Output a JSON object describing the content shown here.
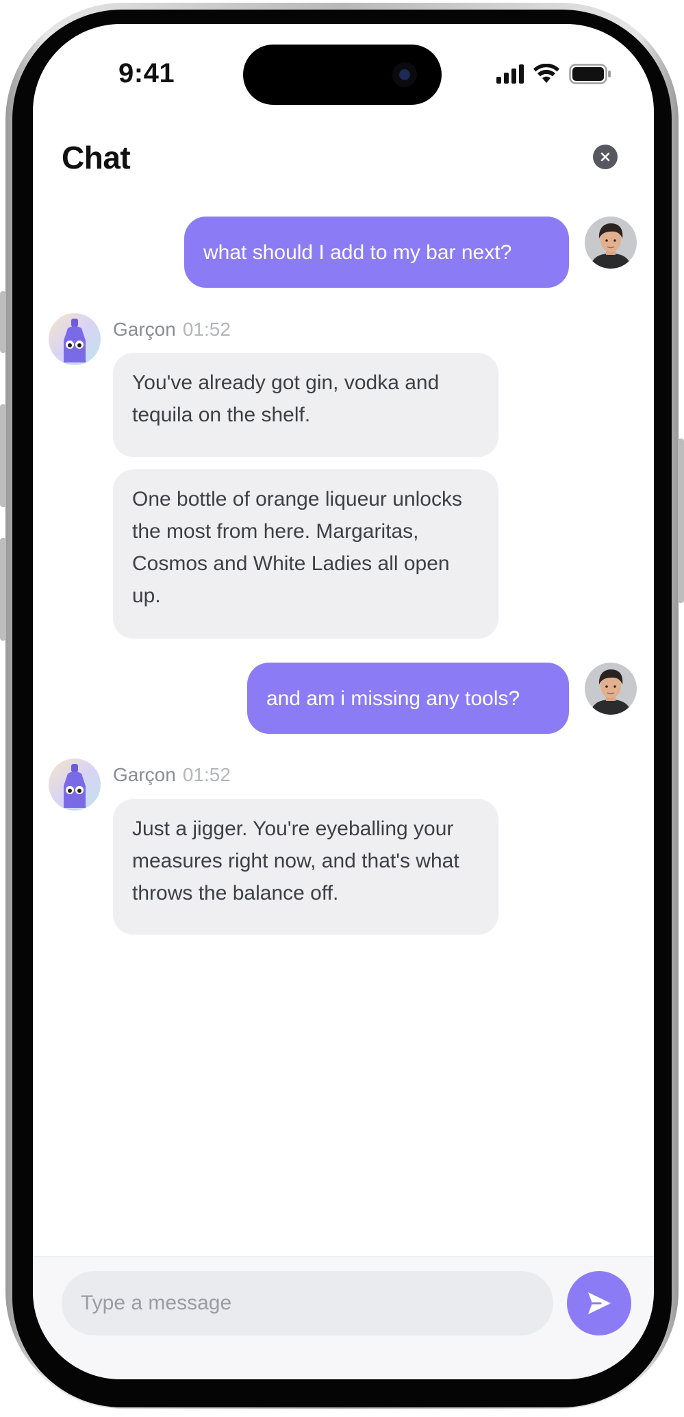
{
  "status_bar": {
    "time": "9:41",
    "icons": [
      "cellular-signal-icon",
      "wifi-icon",
      "battery-icon"
    ]
  },
  "header": {
    "title": "Chat",
    "close_icon": "close-icon"
  },
  "messages": [
    {
      "role": "user",
      "text": "what should I add to my bar next?",
      "avatar": "user-avatar"
    },
    {
      "role": "assistant",
      "sender": "Garçon",
      "time": "01:52",
      "avatar": "garcon-bottle-avatar",
      "bubbles": [
        "You've already got gin, vodka and tequila on the shelf.",
        "One bottle of orange liqueur unlocks the most from here. Margaritas, Cosmos and White Ladies all open up."
      ]
    },
    {
      "role": "user",
      "text": "and am i missing any tools?",
      "avatar": "user-avatar"
    },
    {
      "role": "assistant",
      "sender": "Garçon",
      "time": "01:52",
      "avatar": "garcon-bottle-avatar",
      "bubbles": [
        "Just a jigger. You're eyeballing your measures right now, and that's what throws the balance off."
      ]
    }
  ],
  "composer": {
    "placeholder": "Type a message",
    "value": "",
    "send_icon": "send-icon"
  },
  "colors": {
    "accent": "#8b7cf6",
    "bot_bubble": "#efeff2",
    "bot_text": "#3d3f45",
    "timestamp": "#b4b6bb"
  }
}
